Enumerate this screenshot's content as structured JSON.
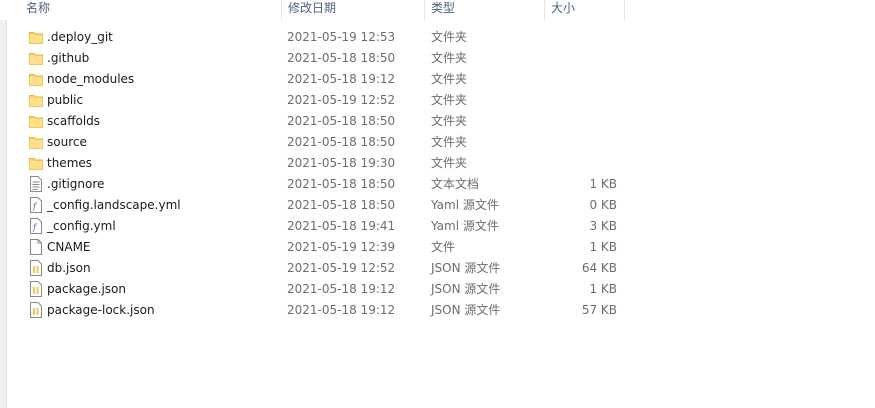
{
  "columns": {
    "name": "名称",
    "date": "修改日期",
    "type": "类型",
    "size": "大小"
  },
  "colors": {
    "folder": "#ffd76a",
    "header_text": "#4d6082"
  },
  "files": [
    {
      "name": ".deploy_git",
      "date": "2021-05-19 12:53",
      "type": "文件夹",
      "size": "",
      "icon": "folder-icon"
    },
    {
      "name": ".github",
      "date": "2021-05-18 18:50",
      "type": "文件夹",
      "size": "",
      "icon": "folder-icon"
    },
    {
      "name": "node_modules",
      "date": "2021-05-18 19:12",
      "type": "文件夹",
      "size": "",
      "icon": "folder-icon"
    },
    {
      "name": "public",
      "date": "2021-05-19 12:52",
      "type": "文件夹",
      "size": "",
      "icon": "folder-icon"
    },
    {
      "name": "scaffolds",
      "date": "2021-05-18 18:50",
      "type": "文件夹",
      "size": "",
      "icon": "folder-icon"
    },
    {
      "name": "source",
      "date": "2021-05-18 18:50",
      "type": "文件夹",
      "size": "",
      "icon": "folder-icon"
    },
    {
      "name": "themes",
      "date": "2021-05-18 19:30",
      "type": "文件夹",
      "size": "",
      "icon": "folder-icon"
    },
    {
      "name": ".gitignore",
      "date": "2021-05-18 18:50",
      "type": "文本文档",
      "size": "1 KB",
      "icon": "text-file-icon"
    },
    {
      "name": "_config.landscape.yml",
      "date": "2021-05-18 18:50",
      "type": "Yaml 源文件",
      "size": "0 KB",
      "icon": "yaml-file-icon"
    },
    {
      "name": "_config.yml",
      "date": "2021-05-18 19:41",
      "type": "Yaml 源文件",
      "size": "3 KB",
      "icon": "yaml-file-icon"
    },
    {
      "name": "CNAME",
      "date": "2021-05-19 12:39",
      "type": "文件",
      "size": "1 KB",
      "icon": "blank-file-icon"
    },
    {
      "name": "db.json",
      "date": "2021-05-19 12:52",
      "type": "JSON 源文件",
      "size": "64 KB",
      "icon": "json-file-icon"
    },
    {
      "name": "package.json",
      "date": "2021-05-18 19:12",
      "type": "JSON 源文件",
      "size": "1 KB",
      "icon": "json-file-icon"
    },
    {
      "name": "package-lock.json",
      "date": "2021-05-18 19:12",
      "type": "JSON 源文件",
      "size": "57 KB",
      "icon": "json-file-icon"
    }
  ]
}
